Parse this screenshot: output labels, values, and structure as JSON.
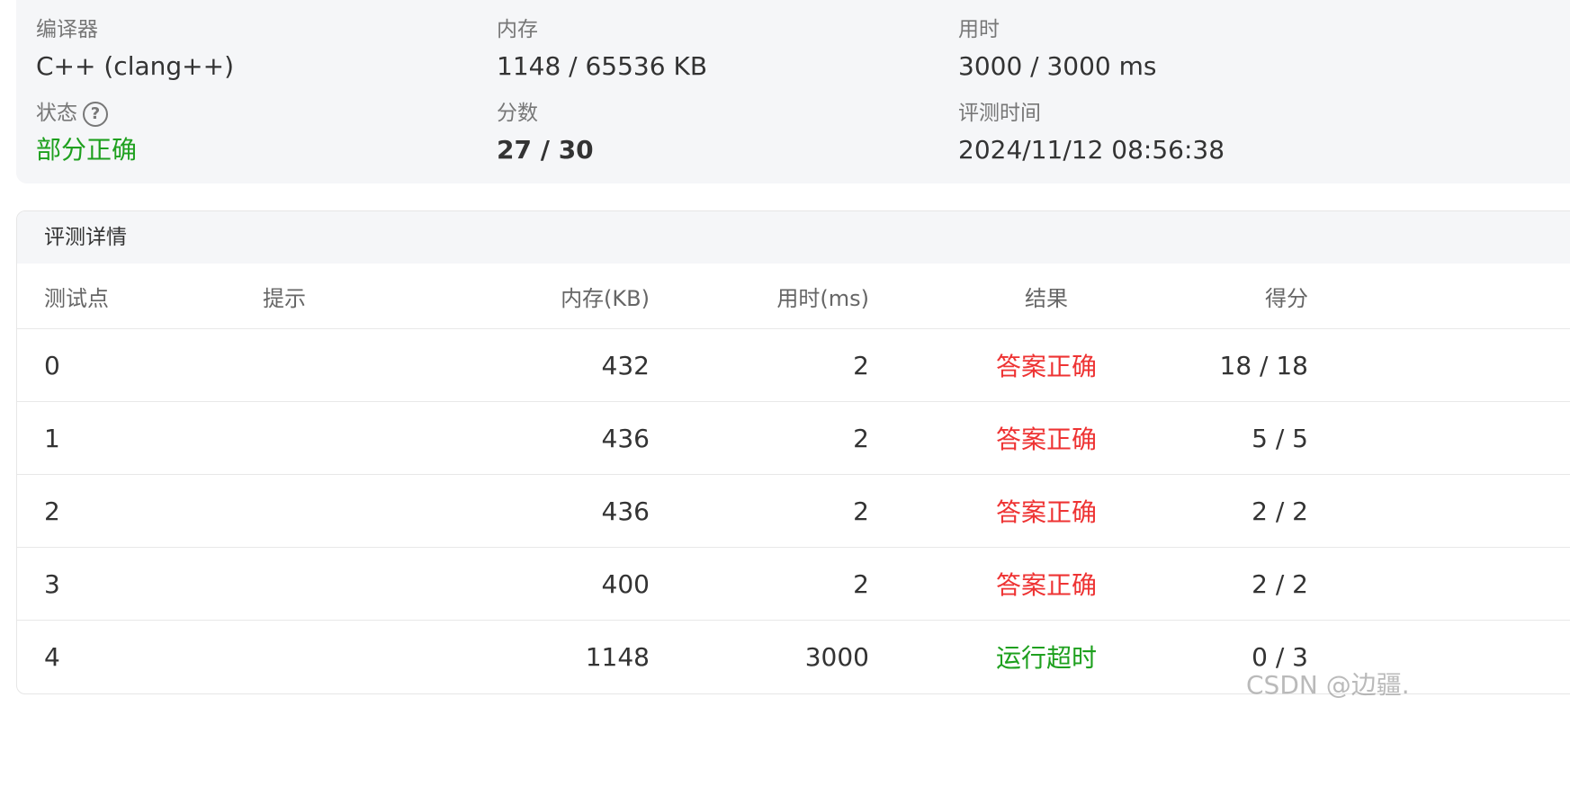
{
  "summary": {
    "compiler_label": "编译器",
    "compiler_value": "C++ (clang++)",
    "memory_label": "内存",
    "memory_value": "1148 / 65536 KB",
    "time_label": "用时",
    "time_value": "3000 / 3000 ms",
    "status_label": "状态",
    "status_help_icon": "question-circle-icon",
    "status_help_glyph": "?",
    "status_value": "部分正确",
    "score_label": "分数",
    "score_value": "27 / 30",
    "judge_time_label": "评测时间",
    "judge_time_value": "2024/11/12 08:56:38"
  },
  "details": {
    "title": "评测详情",
    "columns": {
      "id": "测试点",
      "hint": "提示",
      "memory": "内存(KB)",
      "time": "用时(ms)",
      "result": "结果",
      "score": "得分"
    },
    "rows": [
      {
        "id": "0",
        "hint": "",
        "memory": "432",
        "time": "2",
        "result": "答案正确",
        "score": "18 / 18"
      },
      {
        "id": "1",
        "hint": "",
        "memory": "436",
        "time": "2",
        "result": "答案正确",
        "score": "5 / 5"
      },
      {
        "id": "2",
        "hint": "",
        "memory": "436",
        "time": "2",
        "result": "答案正确",
        "score": "2 / 2"
      },
      {
        "id": "3",
        "hint": "",
        "memory": "400",
        "time": "2",
        "result": "答案正确",
        "score": "2 / 2"
      },
      {
        "id": "4",
        "hint": "",
        "memory": "1148",
        "time": "3000",
        "result": "运行超时",
        "score": "0 / 3"
      }
    ]
  },
  "watermark": "CSDN @边疆.",
  "colors": {
    "accepted": "#ee3333",
    "time_limit": "#1ea01e",
    "partial": "#1ea01e"
  }
}
